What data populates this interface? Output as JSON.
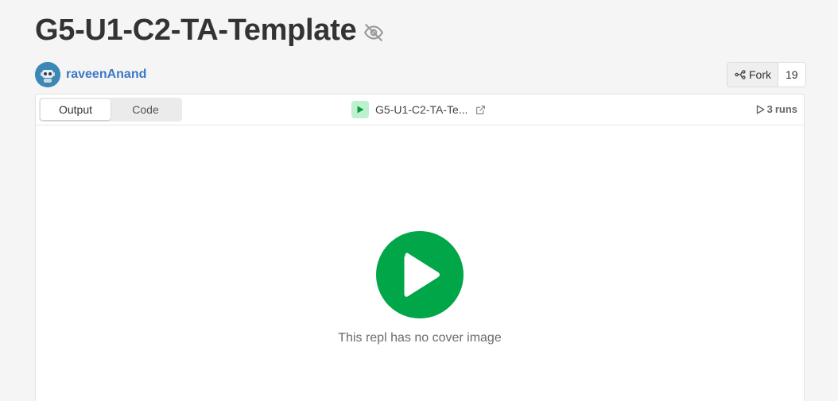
{
  "header": {
    "title": "G5-U1-C2-TA-Template",
    "visibility_icon": "eye-off-icon"
  },
  "author": {
    "name": "raveenAnand",
    "avatar_icon": "robot-avatar"
  },
  "fork": {
    "label": "Fork",
    "count": "19",
    "icon": "fork-icon"
  },
  "tabs": [
    {
      "label": "Output",
      "active": true
    },
    {
      "label": "Code",
      "active": false
    }
  ],
  "repl": {
    "name": "G5-U1-C2-TA-Te...",
    "run_icon": "play-icon",
    "external_icon": "external-link-icon"
  },
  "runs": {
    "count": "3",
    "label": "runs",
    "icon": "play-outline-icon"
  },
  "cover": {
    "message": "This repl has no cover image",
    "play_icon": "play-icon",
    "accent_color": "#00a648"
  },
  "colors": {
    "link": "#3a78c6",
    "background": "#f5f5f5",
    "run_badge": "#bdf0cf"
  }
}
